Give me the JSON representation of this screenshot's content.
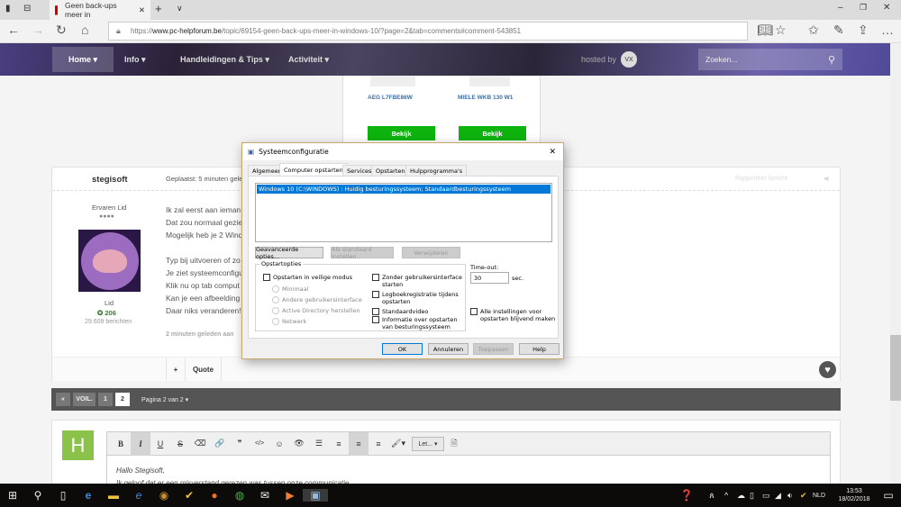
{
  "browser": {
    "tab_title": "Geen back-ups meer in",
    "url_prefix": "https://",
    "url_domain": "www.pc-helpforum.be",
    "url_path": "/topic/69154-geen-back-ups-meer-in-windows-10/?page=2&tab=comments#comment-543851"
  },
  "nav": {
    "items": [
      "Home ▾",
      "Info ▾",
      "Handleidingen & Tips ▾",
      "Activiteit ▾"
    ],
    "hosted_by": "hosted by",
    "search_placeholder": "Zoeken..."
  },
  "ad": {
    "products": [
      {
        "name": "AEG L7FBE86W",
        "button": "Bekijk"
      },
      {
        "name": "MIELE WKB 130 W1",
        "button": "Bekijk"
      }
    ]
  },
  "post": {
    "author": "stegisoft",
    "posted": "Geplaatst: 5 minuten gele",
    "report": "Rapporteer bericht",
    "rank": "Ervaren Lid",
    "pips": "●●●●",
    "group": "Lid",
    "reputation": "206",
    "post_count": "29.609 berichten",
    "lines": [
      "Ik zal eerst aan ieman",
      "Dat zou normaal gezie",
      "Mogelijk heb je 2 Wind",
      "",
      "Typ bij uitvoeren of zo",
      "Je ziet systeemconfigu",
      "Klik nu op tab comput",
      "Kan je een afbeelding",
      "Daar niks veranderen!"
    ],
    "edited": "2 minuten geleden aan",
    "plus": "+",
    "quote": "Quote"
  },
  "pager": {
    "first": "«",
    "prev": "VOIL.",
    "pages": [
      "1",
      "2"
    ],
    "current": "2",
    "label": "Pagina 2 van 2 ▾"
  },
  "reply": {
    "avatar_letter": "H",
    "toolbar": [
      "B",
      "I",
      "U",
      "S",
      "⌫",
      "🔗",
      "❞",
      "</>",
      "☺",
      "👁",
      "☰",
      "≡",
      "≡",
      "≡",
      "🖌▾"
    ],
    "font_select": "Let... ▾",
    "text_lines": [
      "Hallo Stegisoft,",
      "Ik geloof dat er een misverstand gerezen was tussen onze communicatie."
    ]
  },
  "dialog": {
    "title": "Systeemconfiguratie",
    "tabs": [
      "Algemeen",
      "Computer opstarten",
      "Services",
      "Opstarten",
      "Hulpprogramma's"
    ],
    "selected_tab": 1,
    "entries": [
      "Windows 10 (C:\\WINDOWS) : Huidig besturingssysteem; Standaardbesturingssysteem"
    ],
    "buttons": {
      "advanced": "Geavanceerde opties...",
      "set_default": "Als standaard instellen",
      "delete": "Verwijderen",
      "ok": "OK",
      "cancel": "Annuleren",
      "apply": "Toepassen",
      "help": "Help"
    },
    "group_label": "Opstartopties",
    "safe_mode": "Opstarten in veilige modus",
    "radios": [
      "Minimaal",
      "Andere gebruikersinterface",
      "Active Directory herstellen",
      "Netwerk"
    ],
    "checks": [
      "Zonder gebruikersinterface starten",
      "Logboekregistratie tijdens opstarten",
      "Standaardvideo",
      "Informatie over opstarten van besturingssysteem"
    ],
    "timeout_label": "Time-out:",
    "timeout_value": "30",
    "timeout_unit": "sec.",
    "permanent": "Alle instellingen voor opstarten blijvend maken"
  },
  "taskbar": {
    "lang": "NLD",
    "time": "13:53",
    "date": "18/02/2018"
  },
  "colors": {
    "accent_green": "#0eb30e",
    "avatar_green": "#8bc34a",
    "selection": "#0078d7"
  }
}
